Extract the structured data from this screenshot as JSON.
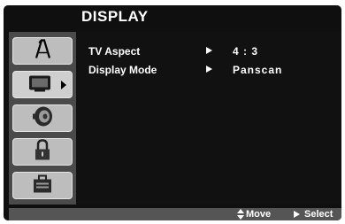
{
  "header": {
    "title": "DISPLAY"
  },
  "sidebar": {
    "tabs": [
      {
        "icon": "language-icon",
        "active": false
      },
      {
        "icon": "display-icon",
        "active": true
      },
      {
        "icon": "audio-icon",
        "active": false
      },
      {
        "icon": "lock-icon",
        "active": false
      },
      {
        "icon": "others-icon",
        "active": false
      }
    ]
  },
  "settings": [
    {
      "label": "TV Aspect",
      "value": "4 : 3"
    },
    {
      "label": "Display Mode",
      "value": "Panscan"
    }
  ],
  "footer": {
    "move_label": "Move",
    "select_label": "Select"
  },
  "colors": {
    "background": "#0f0f0f",
    "sidebar": "#4a4a4a",
    "tab": "#bdbdbd",
    "footer": "#555555",
    "text": "#ffffff"
  }
}
